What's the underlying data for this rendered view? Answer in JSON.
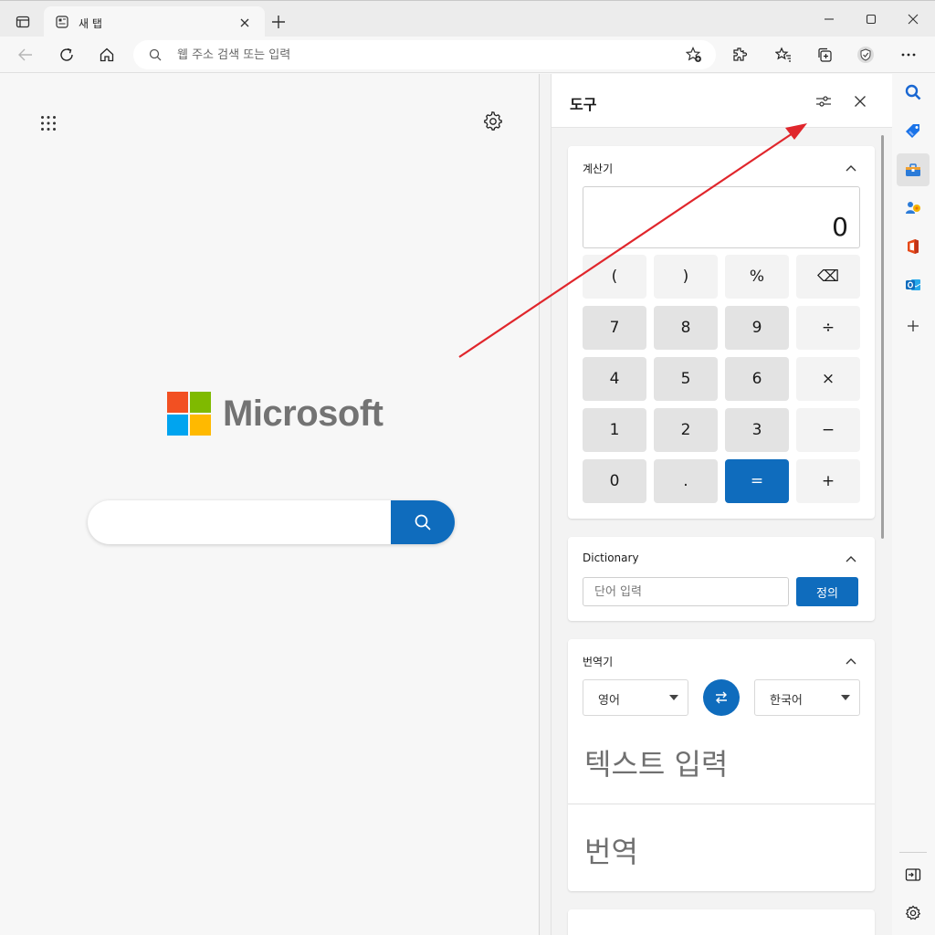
{
  "browser": {
    "tab_title": "새 탭",
    "address_placeholder": "웹 주소 검색 또는 입력"
  },
  "new_tab": {
    "logo_text": "Microsoft",
    "search_value": ""
  },
  "panel": {
    "title": "도구",
    "calculator": {
      "title": "계산기",
      "display": "0",
      "keys": [
        "(",
        ")",
        "%",
        "⌫",
        "7",
        "8",
        "9",
        "÷",
        "4",
        "5",
        "6",
        "×",
        "1",
        "2",
        "3",
        "−",
        "0",
        ".",
        "=",
        "+"
      ]
    },
    "dictionary": {
      "title": "Dictionary",
      "placeholder": "단어 입력",
      "button": "정의"
    },
    "translator": {
      "title": "번역기",
      "source_lang": "영어",
      "target_lang": "한국어",
      "input_placeholder": "텍스트 입력",
      "output_placeholder": "번역"
    }
  },
  "colors": {
    "accent": "#0f6cbd",
    "annotation_arrow": "#e0262c"
  }
}
